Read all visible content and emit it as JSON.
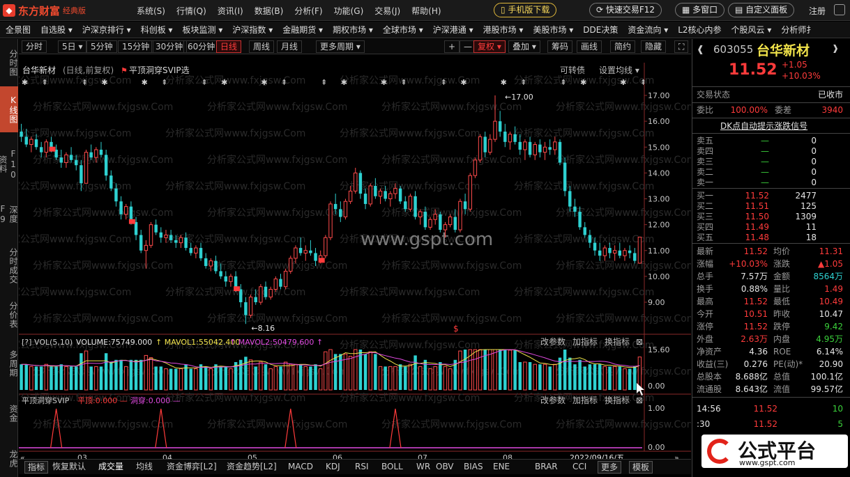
{
  "app": {
    "logo_text": "东方财富",
    "edition": "经典版"
  },
  "top_menu": [
    "系统(S)",
    "行情(Q)",
    "资讯(I)",
    "数据(B)",
    "分析(F)",
    "功能(G)",
    "交易(J)",
    "帮助(H)"
  ],
  "top_buttons": {
    "mobile": "手机版下载",
    "fast_trade": "快速交易F12",
    "multi_window": "多窗口",
    "custom_panel": "自定义面板",
    "register": "注册"
  },
  "nav_items": [
    "全景图",
    "自选股 ▾",
    "沪深京排行 ▾",
    "科创板 ▾",
    "板块监测 ▾",
    "沪深指数 ▾",
    "金融期货 ▾",
    "期权市场 ▾",
    "全球市场 ▾",
    "沪深港通 ▾",
    "港股市场 ▾",
    "美股市场 ▾",
    "DDE决策",
    "资金流向 ▾",
    "L2核心内参",
    "个股风云 ▾",
    "分析师扌"
  ],
  "left_tabs": [
    "分时图",
    "K线图",
    "F10资料",
    "深度F9",
    "分时成交",
    "分价表",
    "多周期",
    "资金",
    "龙虎"
  ],
  "period_tabs": [
    "分时",
    "5日 ▾",
    "5分钟",
    "15分钟",
    "30分钟",
    "60分钟",
    "日线",
    "周线",
    "月线",
    "更多周期 ▾"
  ],
  "chart_tools": [
    "+",
    "—",
    "复权 ▾",
    "叠加 ▾",
    "筹码",
    "画线",
    "简约",
    "隐藏"
  ],
  "chart_header": {
    "stock": "台华新材",
    "mode": "(日线,前复权)",
    "indicator": "平顶洞穿SVIP选",
    "link1": "可转债",
    "link2": "设置均线 ▾"
  },
  "vol_header": {
    "name": "VOL(5,10)",
    "volume": "VOLUME:75749.000",
    "mavol1": "MAVOL1:55042.400",
    "mavol2": "MAVOL2:50479.600",
    "btns": [
      "改参数",
      "加指标",
      "换指标"
    ]
  },
  "ind_header": {
    "name": "平顶洞穿SVIP",
    "ping": "平顶:0.000",
    "dong": "洞穿:0.000",
    "btns": [
      "改参数",
      "加指标",
      "换指标"
    ]
  },
  "watermarks": {
    "site": "www.gspt.com",
    "brand": "公式平台",
    "brand_url": "www.gspt.com"
  },
  "bottom_tabs": [
    "指标",
    "恢复默认",
    "成交量",
    "均线",
    "资金博弈[L2]",
    "资金趋势[L2]",
    "MACD",
    "KDJ",
    "RSI",
    "BOLL",
    "WR",
    "OBV",
    "BIAS",
    "ENE",
    "BRAR",
    "CCI",
    "更多",
    "模板"
  ],
  "date_label": "2022/09/16/五",
  "quote": {
    "code": "603055",
    "name": "台华新材",
    "price": "11.52",
    "change": "+1.05",
    "pct": "+10.03%",
    "status_label": "交易状态",
    "status": "已收市",
    "webi_label": "委比",
    "webi": "100.00%",
    "weicha_label": "委差",
    "weicha": "3940",
    "signal": "DK点自动提示涨跌信号",
    "asks": [
      [
        "卖五",
        "—",
        "0"
      ],
      [
        "卖四",
        "—",
        "0"
      ],
      [
        "卖三",
        "—",
        "0"
      ],
      [
        "卖二",
        "—",
        "0"
      ],
      [
        "卖一",
        "—",
        "0"
      ]
    ],
    "bids": [
      [
        "买一",
        "11.52",
        "2477"
      ],
      [
        "买二",
        "11.51",
        "125"
      ],
      [
        "买三",
        "11.50",
        "1309"
      ],
      [
        "买四",
        "11.49",
        "11"
      ],
      [
        "买五",
        "11.48",
        "18"
      ]
    ],
    "stats": [
      [
        "最新",
        "11.52",
        "均价",
        "11.31"
      ],
      [
        "涨幅",
        "+10.03%",
        "涨跌",
        "▲1.05"
      ],
      [
        "总手",
        "7.57万",
        "金额",
        "8564万"
      ],
      [
        "换手",
        "0.88%",
        "量比",
        "1.49"
      ],
      [
        "最高",
        "11.52",
        "最低",
        "10.49"
      ],
      [
        "今开",
        "10.51",
        "昨收",
        "10.47"
      ],
      [
        "涨停",
        "11.52",
        "跌停",
        "9.42"
      ],
      [
        "外盘",
        "2.63万",
        "内盘",
        "4.95万"
      ],
      [
        "净资产",
        "4.36",
        "ROE",
        "6.14%"
      ],
      [
        "收益(三)",
        "0.276",
        "PE(动)*",
        "20.90"
      ],
      [
        "总股本",
        "8.688亿",
        "总值",
        "100.1亿"
      ],
      [
        "流通股",
        "8.643亿",
        "流值",
        "99.57亿"
      ]
    ],
    "ticks": [
      [
        "14:56",
        "11.52",
        "10"
      ],
      [
        ":30",
        "11.52",
        "5"
      ]
    ]
  },
  "chart_data": {
    "type": "candlestick",
    "title": "台华新材",
    "y_axis_ticks": [
      17.0,
      16.0,
      15.0,
      14.0,
      13.0,
      12.0,
      11.0,
      10.0,
      9.0
    ],
    "x_ticks": [
      "03",
      "04",
      "05",
      "06",
      "07",
      "08"
    ],
    "annotations": {
      "high": 17.0,
      "low": 8.16
    },
    "vol_ticks": [
      15.6,
      0.0
    ],
    "ind_ticks": [
      1.0,
      0.0
    ],
    "ohlc": [
      [
        15.6,
        15.9,
        15.2,
        15.4
      ],
      [
        15.4,
        15.7,
        15.0,
        15.1
      ],
      [
        15.1,
        15.4,
        14.8,
        15.3
      ],
      [
        15.3,
        15.5,
        14.9,
        15.0
      ],
      [
        15.0,
        15.2,
        14.6,
        14.8
      ],
      [
        14.8,
        15.3,
        14.6,
        15.2
      ],
      [
        15.2,
        15.4,
        14.8,
        14.9
      ],
      [
        14.9,
        15.1,
        14.5,
        14.6
      ],
      [
        14.6,
        14.9,
        14.2,
        14.4
      ],
      [
        14.4,
        14.8,
        14.2,
        14.7
      ],
      [
        14.7,
        15.0,
        14.4,
        14.5
      ],
      [
        14.5,
        14.7,
        14.1,
        14.3
      ],
      [
        14.3,
        14.5,
        13.3,
        13.6
      ],
      [
        13.6,
        14.9,
        13.6,
        14.8
      ],
      [
        14.8,
        15.1,
        14.5,
        14.6
      ],
      [
        14.6,
        15.0,
        14.4,
        14.9
      ],
      [
        14.9,
        15.2,
        14.6,
        14.7
      ],
      [
        14.7,
        14.9,
        13.7,
        13.9
      ],
      [
        13.9,
        14.1,
        13.3,
        13.4
      ],
      [
        13.4,
        13.6,
        12.7,
        12.9
      ],
      [
        12.9,
        13.1,
        12.2,
        12.4
      ],
      [
        12.4,
        12.8,
        12.2,
        12.7
      ],
      [
        12.7,
        12.9,
        12.0,
        12.1
      ],
      [
        12.1,
        12.3,
        11.4,
        11.6
      ],
      [
        11.6,
        11.8,
        10.9,
        11.0
      ],
      [
        11.0,
        11.4,
        10.3,
        11.2
      ],
      [
        11.2,
        12.1,
        11.1,
        12.0
      ],
      [
        12.0,
        12.2,
        11.6,
        11.7
      ],
      [
        11.7,
        11.9,
        11.3,
        11.5
      ],
      [
        11.5,
        11.8,
        11.3,
        11.6
      ],
      [
        11.6,
        11.8,
        11.3,
        11.4
      ],
      [
        11.4,
        11.6,
        11.1,
        11.3
      ],
      [
        11.3,
        11.6,
        11.1,
        11.5
      ],
      [
        11.5,
        11.7,
        11.0,
        11.1
      ],
      [
        11.1,
        11.3,
        10.8,
        10.9
      ],
      [
        10.9,
        11.2,
        10.7,
        11.1
      ],
      [
        11.1,
        11.3,
        10.6,
        10.7
      ],
      [
        10.7,
        10.9,
        10.3,
        10.4
      ],
      [
        10.4,
        10.7,
        10.2,
        10.6
      ],
      [
        10.6,
        10.8,
        10.1,
        10.2
      ],
      [
        10.2,
        10.5,
        9.9,
        10.0
      ],
      [
        10.0,
        10.2,
        9.6,
        9.8
      ],
      [
        9.8,
        10.1,
        9.6,
        10.0
      ],
      [
        10.0,
        10.2,
        9.4,
        9.5
      ],
      [
        9.5,
        9.7,
        8.8,
        9.0
      ],
      [
        9.0,
        9.2,
        8.16,
        8.5
      ],
      [
        8.5,
        9.3,
        8.4,
        9.2
      ],
      [
        9.2,
        9.5,
        8.9,
        9.0
      ],
      [
        9.0,
        9.7,
        8.9,
        9.6
      ],
      [
        9.6,
        9.8,
        9.1,
        9.2
      ],
      [
        9.2,
        9.6,
        9.1,
        9.5
      ],
      [
        9.5,
        10.0,
        9.4,
        9.9
      ],
      [
        9.9,
        10.1,
        9.5,
        9.6
      ],
      [
        9.6,
        10.3,
        9.5,
        10.2
      ],
      [
        10.2,
        10.8,
        10.1,
        10.7
      ],
      [
        10.7,
        11.2,
        10.5,
        11.1
      ],
      [
        11.1,
        11.5,
        10.8,
        10.9
      ],
      [
        10.9,
        11.2,
        10.6,
        11.0
      ],
      [
        11.0,
        11.4,
        10.8,
        10.9
      ],
      [
        10.9,
        11.1,
        10.4,
        10.6
      ],
      [
        10.6,
        11.0,
        10.5,
        10.8
      ],
      [
        10.8,
        11.6,
        10.7,
        11.5
      ],
      [
        11.5,
        12.9,
        11.4,
        12.8
      ],
      [
        12.8,
        13.2,
        12.4,
        12.6
      ],
      [
        12.6,
        12.9,
        12.1,
        12.3
      ],
      [
        12.3,
        13.0,
        12.2,
        12.9
      ],
      [
        12.9,
        13.5,
        12.8,
        13.3
      ],
      [
        13.3,
        14.2,
        13.2,
        14.0
      ],
      [
        14.0,
        14.1,
        13.0,
        13.2
      ],
      [
        13.2,
        13.4,
        12.6,
        12.8
      ],
      [
        12.8,
        13.6,
        12.7,
        13.5
      ],
      [
        13.5,
        13.8,
        13.0,
        13.1
      ],
      [
        13.1,
        13.4,
        12.8,
        13.3
      ],
      [
        13.3,
        13.5,
        12.9,
        13.0
      ],
      [
        13.0,
        13.3,
        12.7,
        13.2
      ],
      [
        13.2,
        13.6,
        13.0,
        13.4
      ],
      [
        13.4,
        13.5,
        12.8,
        12.9
      ],
      [
        12.9,
        13.1,
        12.5,
        12.6
      ],
      [
        12.6,
        13.2,
        12.5,
        13.1
      ],
      [
        13.1,
        13.3,
        12.2,
        12.3
      ],
      [
        12.3,
        12.6,
        12.0,
        12.5
      ],
      [
        12.5,
        12.7,
        11.8,
        11.9
      ],
      [
        11.9,
        12.3,
        11.8,
        12.2
      ],
      [
        12.2,
        12.6,
        12.0,
        12.4
      ],
      [
        12.4,
        12.5,
        11.7,
        11.8
      ],
      [
        11.8,
        12.1,
        11.5,
        12.0
      ],
      [
        12.0,
        12.4,
        11.9,
        12.3
      ],
      [
        12.3,
        12.6,
        11.7,
        11.8
      ],
      [
        11.8,
        13.0,
        11.7,
        12.9
      ],
      [
        12.9,
        13.2,
        12.4,
        12.6
      ],
      [
        12.6,
        14.0,
        12.5,
        13.9
      ],
      [
        13.9,
        14.6,
        13.8,
        14.5
      ],
      [
        14.5,
        15.5,
        14.4,
        15.4
      ],
      [
        15.4,
        15.6,
        14.6,
        14.8
      ],
      [
        14.8,
        15.5,
        14.7,
        15.3
      ],
      [
        15.3,
        17.0,
        15.2,
        16.0
      ],
      [
        16.0,
        16.4,
        15.4,
        15.6
      ],
      [
        15.6,
        15.9,
        15.0,
        15.2
      ],
      [
        15.2,
        15.6,
        14.9,
        15.5
      ],
      [
        15.5,
        15.8,
        15.1,
        15.2
      ],
      [
        15.2,
        15.5,
        14.7,
        14.9
      ],
      [
        14.9,
        15.3,
        14.5,
        15.2
      ],
      [
        15.2,
        15.4,
        14.6,
        14.7
      ],
      [
        14.7,
        15.2,
        14.5,
        15.1
      ],
      [
        15.1,
        15.3,
        14.6,
        14.8
      ],
      [
        14.8,
        15.2,
        14.5,
        15.0
      ],
      [
        15.0,
        15.3,
        14.7,
        14.9
      ],
      [
        14.9,
        15.4,
        14.7,
        15.2
      ],
      [
        15.2,
        15.3,
        14.3,
        14.4
      ],
      [
        14.4,
        14.6,
        13.1,
        13.3
      ],
      [
        13.3,
        13.5,
        12.5,
        12.7
      ],
      [
        12.7,
        13.0,
        12.3,
        12.5
      ],
      [
        12.5,
        12.7,
        11.8,
        11.9
      ],
      [
        11.9,
        12.1,
        11.5,
        11.6
      ],
      [
        11.6,
        11.8,
        11.1,
        11.3
      ],
      [
        11.3,
        11.5,
        10.8,
        11.0
      ],
      [
        11.0,
        11.3,
        10.6,
        10.8
      ],
      [
        10.8,
        11.2,
        10.6,
        11.1
      ],
      [
        11.1,
        11.3,
        10.7,
        10.9
      ],
      [
        10.9,
        11.2,
        10.6,
        11.0
      ],
      [
        11.0,
        11.3,
        10.7,
        10.8
      ],
      [
        10.8,
        11.1,
        10.6,
        11.0
      ],
      [
        11.0,
        11.2,
        10.7,
        10.9
      ],
      [
        10.9,
        11.1,
        10.5,
        10.6
      ],
      [
        10.51,
        11.52,
        10.49,
        11.52
      ]
    ]
  }
}
